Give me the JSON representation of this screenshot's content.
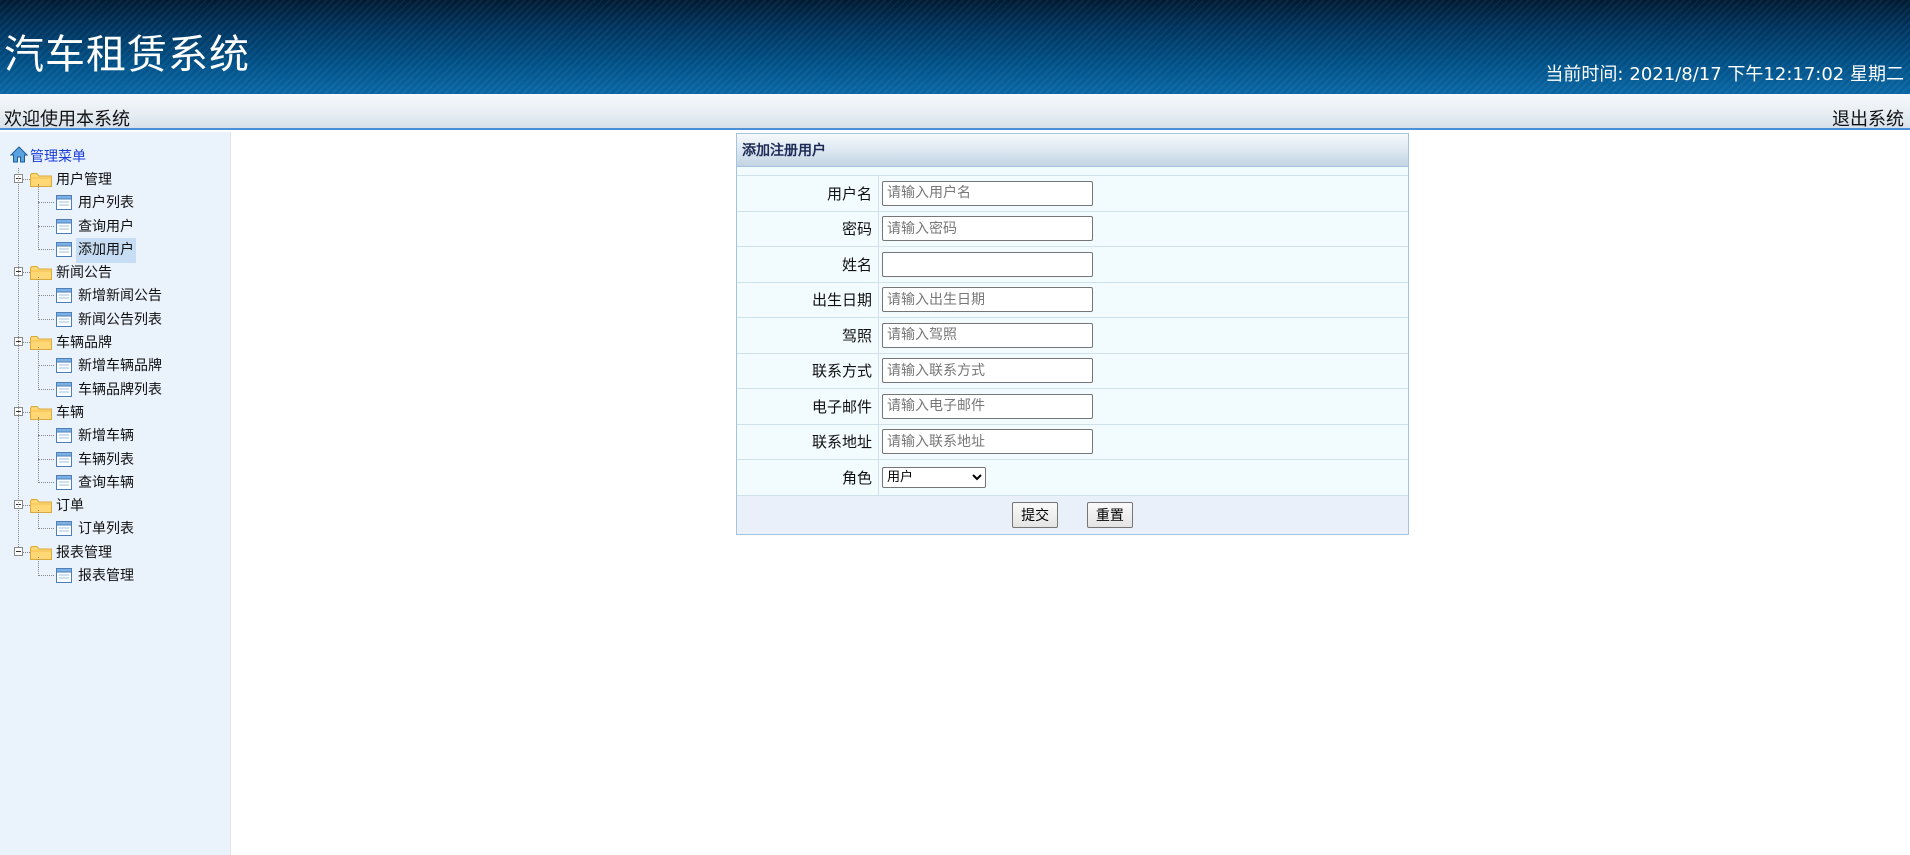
{
  "header": {
    "title": "汽车租赁系统",
    "clock_label": "当前时间:",
    "clock_value": "2021/8/17 下午12:17:02 星期二"
  },
  "welcome_bar": {
    "welcome": "欢迎使用本系统",
    "logout": "退出系统"
  },
  "sidebar": {
    "root": "管理菜单",
    "groups": [
      {
        "label": "用户管理",
        "items": [
          "用户列表",
          "查询用户",
          "添加用户"
        ]
      },
      {
        "label": "新闻公告",
        "items": [
          "新增新闻公告",
          "新闻公告列表"
        ]
      },
      {
        "label": "车辆品牌",
        "items": [
          "新增车辆品牌",
          "车辆品牌列表"
        ]
      },
      {
        "label": "车辆",
        "items": [
          "新增车辆",
          "车辆列表",
          "查询车辆"
        ]
      },
      {
        "label": "订单",
        "items": [
          "订单列表"
        ]
      },
      {
        "label": "报表管理",
        "items": [
          "报表管理"
        ]
      }
    ],
    "selected": "添加用户"
  },
  "form": {
    "title": "添加注册用户",
    "fields": [
      {
        "label": "用户名",
        "placeholder": "请输入用户名",
        "value": ""
      },
      {
        "label": "密码",
        "placeholder": "请输入密码",
        "value": ""
      },
      {
        "label": "姓名",
        "placeholder": "",
        "value": ""
      },
      {
        "label": "出生日期",
        "placeholder": "请输入出生日期",
        "value": ""
      },
      {
        "label": "驾照",
        "placeholder": "请输入驾照",
        "value": ""
      },
      {
        "label": "联系方式",
        "placeholder": "请输入联系方式",
        "value": ""
      },
      {
        "label": "电子邮件",
        "placeholder": "请输入电子邮件",
        "value": ""
      },
      {
        "label": "联系地址",
        "placeholder": "请输入联系地址",
        "value": ""
      }
    ],
    "role_label": "角色",
    "role_selected": "用户",
    "submit": "提交",
    "reset": "重置"
  },
  "colors": {
    "header_dark": "#001b33",
    "header_light": "#0a67a4",
    "sidebar_bg": "#eaf2fc",
    "accent_line": "#4a90d9"
  }
}
